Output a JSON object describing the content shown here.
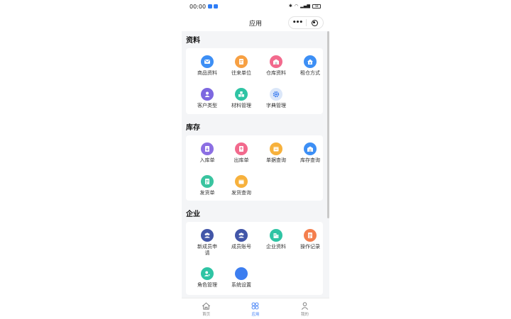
{
  "status_bar": {
    "time": "00:00",
    "battery": "58"
  },
  "nav": {
    "title": "应用",
    "more_label": "•••"
  },
  "sections": [
    {
      "title": "资料",
      "items": [
        {
          "label": "商品资料",
          "icon": "mail-icon",
          "color": "#3d8ff5"
        },
        {
          "label": "往来单位",
          "icon": "document-icon",
          "color": "#f7a043"
        },
        {
          "label": "仓库资料",
          "icon": "warehouse-icon",
          "color": "#f26a8d"
        },
        {
          "label": "租仓方式",
          "icon": "home-icon",
          "color": "#3d8ff5"
        },
        {
          "label": "客户类型",
          "icon": "user-icon",
          "color": "#7d68e0"
        },
        {
          "label": "材料管理",
          "icon": "boxes-icon",
          "color": "#2fc4a4"
        },
        {
          "label": "字典管理",
          "icon": "gear-icon",
          "color": "#dbe7f9"
        }
      ]
    },
    {
      "title": "库存",
      "items": [
        {
          "label": "入库单",
          "icon": "inbound-icon",
          "color": "#8c6fe3"
        },
        {
          "label": "出库单",
          "icon": "outbound-icon",
          "color": "#f26a8d"
        },
        {
          "label": "单据查询",
          "icon": "calendar-icon",
          "color": "#f7b13c"
        },
        {
          "label": "库存查询",
          "icon": "warehouse-icon",
          "color": "#3d8ff5"
        },
        {
          "label": "发货单",
          "icon": "invoice-icon",
          "color": "#3ac4a0"
        },
        {
          "label": "发货查询",
          "icon": "box-icon",
          "color": "#f7b13c"
        }
      ]
    },
    {
      "title": "企业",
      "items": [
        {
          "label": "新成员申请",
          "icon": "team-icon",
          "color": "#4256a8"
        },
        {
          "label": "成员账号",
          "icon": "team-icon",
          "color": "#4256a8"
        },
        {
          "label": "企业资料",
          "icon": "building-icon",
          "color": "#2fc4a4"
        },
        {
          "label": "操作记录",
          "icon": "log-icon",
          "color": "#f47f4e"
        },
        {
          "label": "角色管理",
          "icon": "role-icon",
          "color": "#2fc4a4"
        },
        {
          "label": "系统设置",
          "icon": "gear-icon",
          "color": "#3d7ef0"
        }
      ]
    }
  ],
  "tabs": [
    {
      "label": "首页",
      "icon": "home-icon",
      "active": false
    },
    {
      "label": "应用",
      "icon": "apps-icon",
      "active": true
    },
    {
      "label": "我的",
      "icon": "profile-icon",
      "active": false
    }
  ]
}
